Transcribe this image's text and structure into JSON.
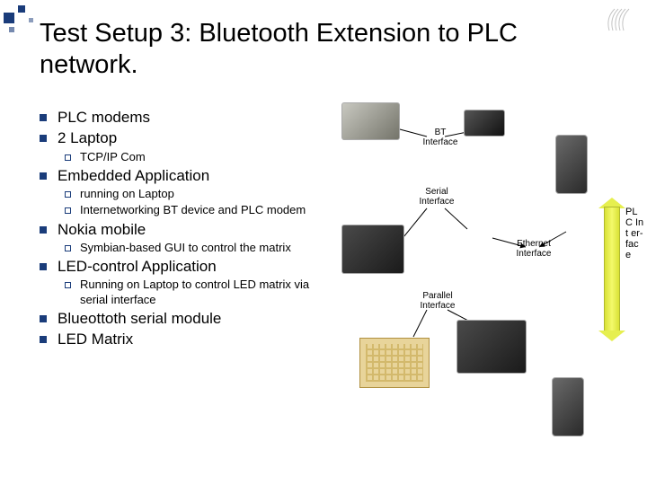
{
  "title": "Test Setup 3: Bluetooth Extension to PLC network.",
  "bullets": [
    {
      "text": "PLC modems",
      "subs": []
    },
    {
      "text": "2 Laptop",
      "subs": [
        {
          "text": "TCP/IP Com"
        }
      ]
    },
    {
      "text": "Embedded Application",
      "subs": [
        {
          "text": "running on Laptop"
        },
        {
          "text": "Internetworking BT device and PLC modem"
        }
      ]
    },
    {
      "text": "Nokia mobile",
      "subs": [
        {
          "text": "Symbian-based GUI to control the matrix"
        }
      ]
    },
    {
      "text": "LED-control Application",
      "subs": [
        {
          "text": "Running on Laptop to control LED matrix via serial interface"
        }
      ]
    },
    {
      "text": "Blueottoth serial module",
      "subs": []
    },
    {
      "text": "LED Matrix",
      "subs": []
    }
  ],
  "labels": {
    "bt": "BT Interface",
    "serial": "Serial Interface",
    "ethernet": "Ethernet Interface",
    "parallel": "Parallel Interface",
    "plc": "PL C Int er-fac e"
  }
}
